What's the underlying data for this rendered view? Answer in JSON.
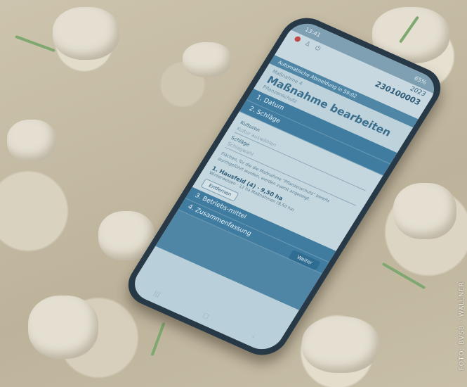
{
  "status": {
    "time": "13:41",
    "battery": "65%"
  },
  "header": {
    "account": "230100003",
    "year": "2023"
  },
  "breadcrumb": "Automatische Abmeldung in 59:02",
  "page": {
    "subtitle": "Maßnahme 4",
    "title": "Maßnahme bearbeiten",
    "note": "Pflanzenschutz"
  },
  "steps": [
    "1. Datum",
    "2. Schläge",
    "3. Betriebs-mittel",
    "4. Zusammenfassung"
  ],
  "form": {
    "kulturen_label": "Kulturen",
    "kulturen_placeholder": "Kultur auswählen",
    "schlaege_label": "Schläge",
    "schlaege_placeholder": "Schlagwahl",
    "hint": "Flächen, für die die Maßnahme \"Pflanzenschutz\" bereits durchgeführt wurden, werden zuerst angezeigt.",
    "entry_title": "1. Hausfeld (4) · 9,50 ha",
    "entry_sub": "Winterweizen · 12 ha Maßnahmen (9,50 ha)",
    "remove_label": "Entfernen",
    "next_label": "Weiter"
  },
  "credit": "FOTO: BVSB · WALLNER"
}
